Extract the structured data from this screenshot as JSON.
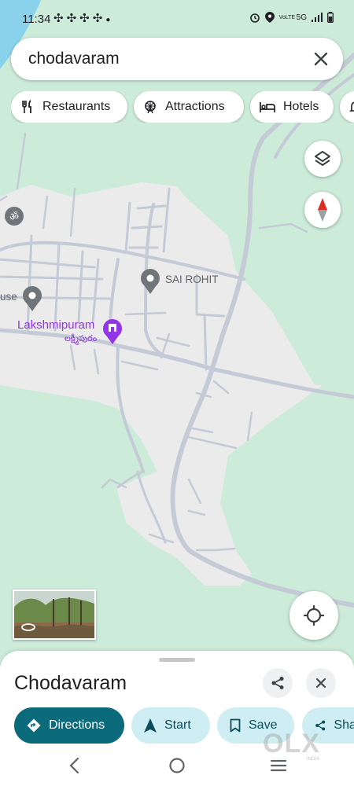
{
  "status_bar": {
    "time": "11:34",
    "network": "5G",
    "volte_label": "VoLTE"
  },
  "search": {
    "query": "chodavaram"
  },
  "chips": [
    {
      "label": "Restaurants",
      "icon": "fork-knife-icon"
    },
    {
      "label": "Attractions",
      "icon": "ferris-wheel-icon"
    },
    {
      "label": "Hotels",
      "icon": "bed-icon"
    }
  ],
  "map": {
    "labels": {
      "place_pin": "SAI ROHIT",
      "village": "Lakshmipuram",
      "village_local": "లక్ష్మీపురం",
      "partial_left": "use"
    },
    "colors": {
      "land": "#cdebd9",
      "settlement": "#ebebeb",
      "road": "#c4cad6",
      "water": "#8ad1ec",
      "compass_red": "#d93025",
      "purple": "#9334e6"
    }
  },
  "place_sheet": {
    "title": "Chodavaram",
    "actions": [
      {
        "label": "Directions",
        "icon": "directions-icon"
      },
      {
        "label": "Start",
        "icon": "navigation-arrow-icon"
      },
      {
        "label": "Save",
        "icon": "bookmark-icon"
      },
      {
        "label": "Sha",
        "icon": "share-icon"
      }
    ]
  },
  "watermark": {
    "brand": "OLX",
    "sub": "INDIA"
  }
}
